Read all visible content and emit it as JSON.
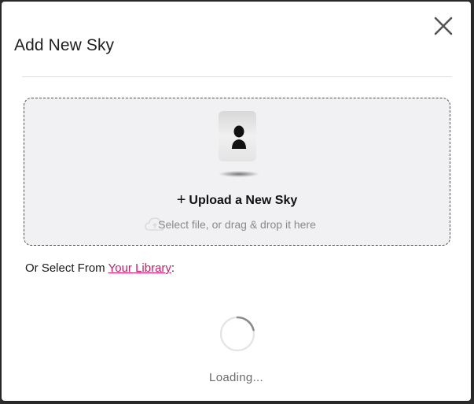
{
  "modal": {
    "title": "Add New Sky",
    "close_icon": "close-icon"
  },
  "upload": {
    "plus": "+",
    "title": "Upload a New Sky",
    "subtitle": "Select file, or drag & drop it here",
    "illustration_icon": "sky-person-icon",
    "cloud_icon": "cloud-upload-icon"
  },
  "library": {
    "prefix": "Or Select From ",
    "link_label": "Your Library",
    "suffix": ":",
    "link_color": "#d0186a"
  },
  "loading": {
    "text": "Loading...",
    "spinner_icon": "loading-spinner-icon"
  }
}
